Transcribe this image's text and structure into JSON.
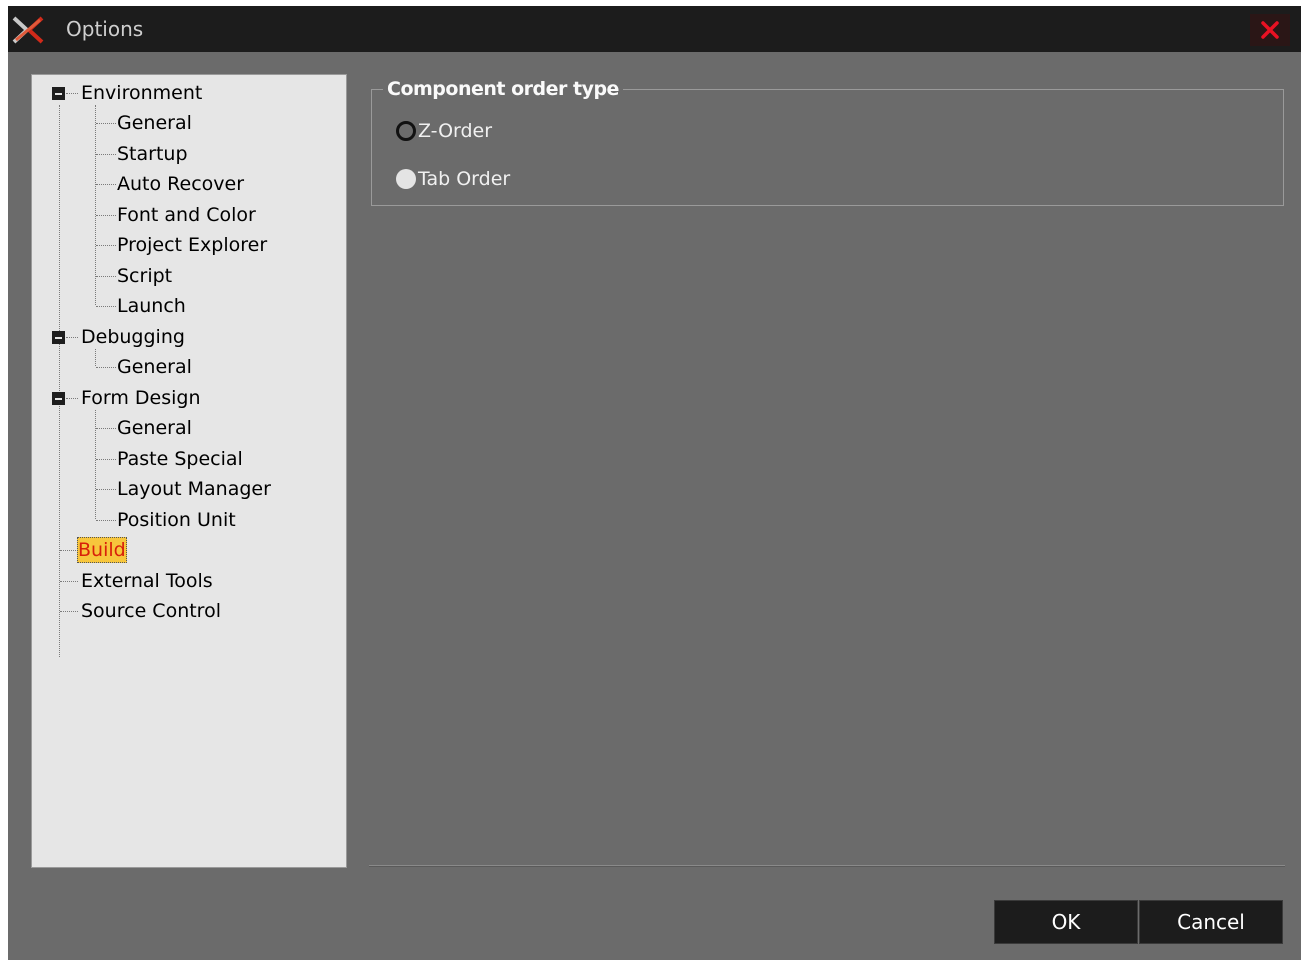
{
  "window": {
    "title": "Options",
    "close_icon": "close-icon",
    "app_icon": "app-logo-icon"
  },
  "tree": {
    "items": [
      {
        "label": "Environment",
        "expanded": true
      },
      {
        "label": "General"
      },
      {
        "label": "Startup"
      },
      {
        "label": "Auto Recover"
      },
      {
        "label": "Font and Color"
      },
      {
        "label": "Project Explorer"
      },
      {
        "label": "Script"
      },
      {
        "label": "Launch"
      },
      {
        "label": "Debugging",
        "expanded": true
      },
      {
        "label": "General"
      },
      {
        "label": "Form Design",
        "expanded": true
      },
      {
        "label": "General"
      },
      {
        "label": "Paste Special"
      },
      {
        "label": "Layout Manager"
      },
      {
        "label": "Position Unit"
      },
      {
        "label": "Build",
        "selected": true
      },
      {
        "label": "External Tools"
      },
      {
        "label": "Source Control"
      }
    ]
  },
  "group": {
    "title": "Component order type",
    "options": [
      {
        "label": "Z-Order",
        "checked": true
      },
      {
        "label": "Tab Order",
        "checked": false
      }
    ]
  },
  "buttons": {
    "ok": "OK",
    "cancel": "Cancel"
  },
  "colors": {
    "selection_bg": "#f7c63c",
    "selection_text": "#d8200a",
    "close_icon": "#e81123",
    "window_bg": "#6b6b6b"
  }
}
